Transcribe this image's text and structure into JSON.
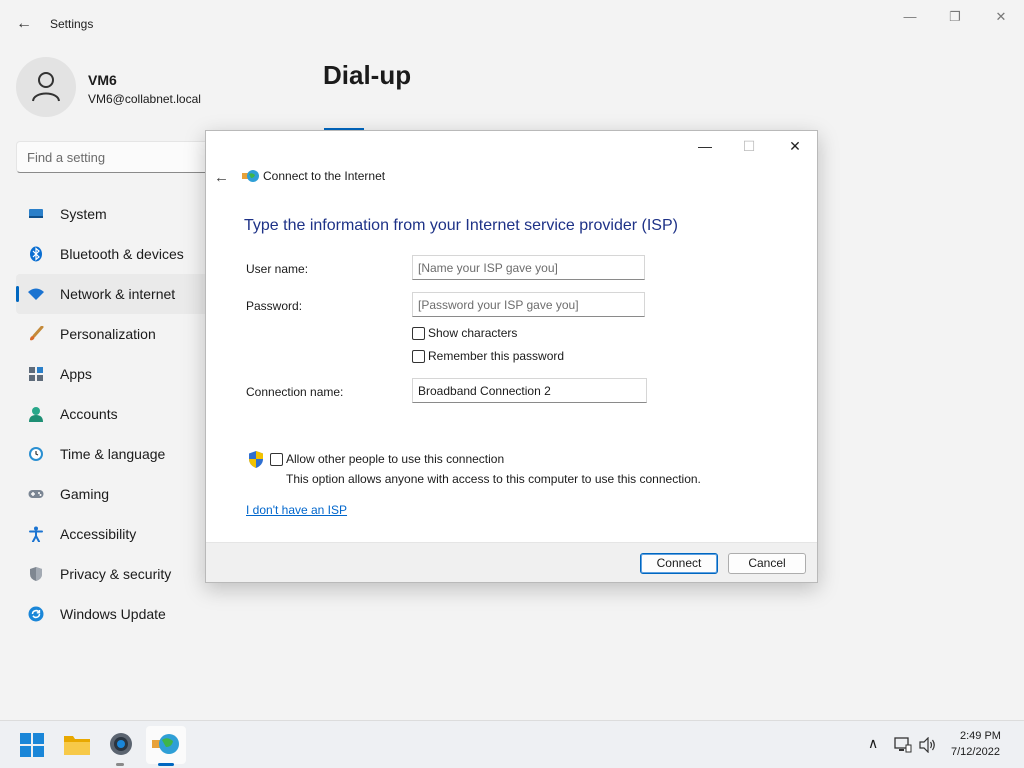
{
  "app": {
    "title": "Settings",
    "window_controls": {
      "minimize": "—",
      "maximize": "❐",
      "close": "✕"
    }
  },
  "profile": {
    "name": "VM6",
    "email": "VM6@collabnet.local"
  },
  "search": {
    "placeholder": "Find a setting"
  },
  "sidebar": {
    "items": [
      {
        "label": "System",
        "icon": "system-icon"
      },
      {
        "label": "Bluetooth & devices",
        "icon": "bluetooth-icon"
      },
      {
        "label": "Network & internet",
        "icon": "wifi-icon",
        "active": true
      },
      {
        "label": "Personalization",
        "icon": "brush-icon"
      },
      {
        "label": "Apps",
        "icon": "apps-icon"
      },
      {
        "label": "Accounts",
        "icon": "accounts-icon"
      },
      {
        "label": "Time & language",
        "icon": "clock-icon"
      },
      {
        "label": "Gaming",
        "icon": "gamepad-icon"
      },
      {
        "label": "Accessibility",
        "icon": "accessibility-icon"
      },
      {
        "label": "Privacy & security",
        "icon": "shield-icon"
      },
      {
        "label": "Windows Update",
        "icon": "update-icon"
      }
    ]
  },
  "page": {
    "title": "Dial-up"
  },
  "dialog": {
    "caption": "Connect to the Internet",
    "heading": "Type the information from your Internet service provider (ISP)",
    "username": {
      "label": "User name:",
      "placeholder": "[Name your ISP gave you]",
      "value": ""
    },
    "password": {
      "label": "Password:",
      "placeholder": "[Password your ISP gave you]",
      "value": ""
    },
    "show_characters": {
      "label": "Show characters",
      "checked": false
    },
    "remember_password": {
      "label": "Remember this password",
      "checked": false
    },
    "connection_name": {
      "label": "Connection name:",
      "value": "Broadband Connection 2"
    },
    "allow_others": {
      "label": "Allow other people to use this connection",
      "checked": false
    },
    "allow_others_desc": "This option allows anyone with access to this computer to use this connection.",
    "no_isp_link": "I don't have an ISP",
    "connect_button": "Connect",
    "cancel_button": "Cancel"
  },
  "taskbar": {
    "time": "2:49 PM",
    "date": "7/12/2022",
    "icons": [
      "start-icon",
      "file-explorer-icon",
      "settings-icon",
      "dialup-connection-icon"
    ]
  },
  "colors": {
    "accent": "#0067c0",
    "heading": "#1e3287",
    "link": "#0066cc"
  }
}
